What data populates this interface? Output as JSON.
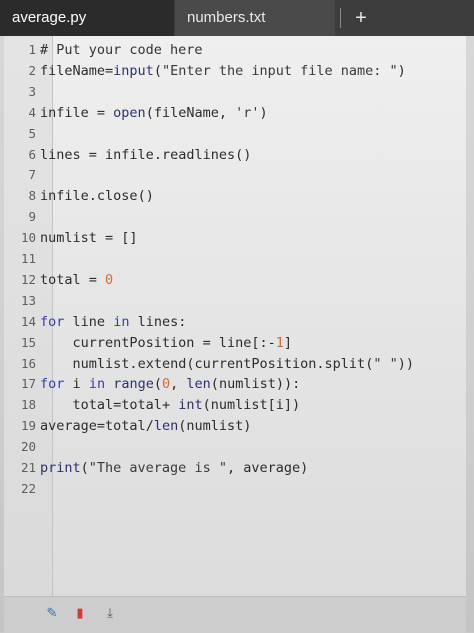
{
  "tabs": [
    {
      "label": "average.py",
      "active": true
    },
    {
      "label": "numbers.txt",
      "active": false
    }
  ],
  "add_tab_label": "+",
  "colors": {
    "keyword": "#3b3bb0",
    "number": "#d86a2c",
    "tabbar": "#3d3d3d"
  },
  "lines": [
    {
      "num": "1",
      "code": "# Put your code here"
    },
    {
      "num": "2",
      "code": "fileName=input(\"Enter the input file name: \")"
    },
    {
      "num": "3",
      "code": ""
    },
    {
      "num": "4",
      "code": "infile = open(fileName, 'r')"
    },
    {
      "num": "5",
      "code": ""
    },
    {
      "num": "6",
      "code": "lines = infile.readlines()"
    },
    {
      "num": "7",
      "code": ""
    },
    {
      "num": "8",
      "code": "infile.close()"
    },
    {
      "num": "9",
      "code": ""
    },
    {
      "num": "10",
      "code": "numlist = []"
    },
    {
      "num": "11",
      "code": ""
    },
    {
      "num": "12",
      "code": "total = 0"
    },
    {
      "num": "13",
      "code": ""
    },
    {
      "num": "14",
      "code": "for line in lines:"
    },
    {
      "num": "15",
      "code": "    currentPosition = line[:-1]"
    },
    {
      "num": "16",
      "code": "    numlist.extend(currentPosition.split(\" \"))"
    },
    {
      "num": "17",
      "code": "for i in range(0, len(numlist)):"
    },
    {
      "num": "18",
      "code": "    total=total+ int(numlist[i])"
    },
    {
      "num": "19",
      "code": "average=total/len(numlist)"
    },
    {
      "num": "20",
      "code": ""
    },
    {
      "num": "21",
      "code": "print(\"The average is \", average)"
    },
    {
      "num": "22",
      "code": ""
    }
  ],
  "footer_icons": [
    "pencil-icon",
    "trash-icon",
    "download-icon"
  ]
}
